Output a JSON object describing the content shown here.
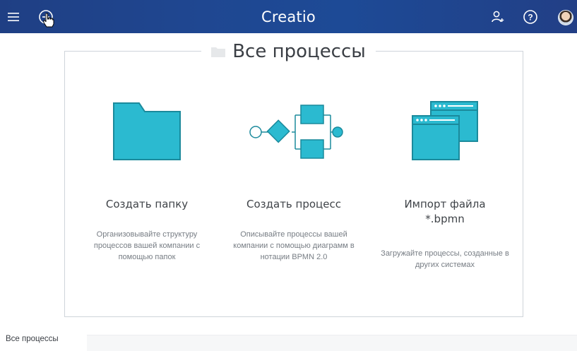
{
  "topbar": {
    "brand": "Creatio",
    "menu_icon": "hamburger-icon",
    "add_icon": "add-circle-icon",
    "profile_icon": "user-add-icon",
    "help_icon": "help-icon",
    "avatar_icon": "user-avatar"
  },
  "panel": {
    "title": "Все процессы",
    "items": [
      {
        "icon": "folder-icon",
        "title": "Создать папку",
        "description": "Организовывайте структуру процессов вашей компании с помощью папок"
      },
      {
        "icon": "bpmn-diagram-icon",
        "title": "Создать процесс",
        "description": "Описывайте процессы вашей компании с помощью диаграмм в нотации BPMN 2.0"
      },
      {
        "icon": "import-windows-icon",
        "title": "Импорт файла *.bpmn",
        "description": "Загружайте процессы, созданные в других системах"
      }
    ]
  },
  "bottom": {
    "tab_label": "Все процессы"
  },
  "colors": {
    "accent": "#2bbad0",
    "accent_dark": "#1b8a9c",
    "topbar": "#1f4791"
  }
}
